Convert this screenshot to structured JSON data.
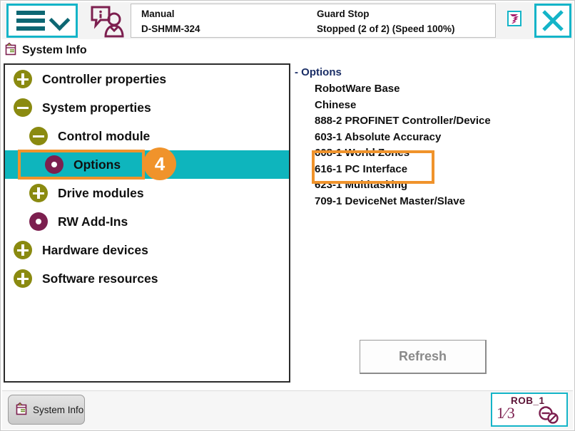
{
  "header": {
    "menu_button_label": "menu",
    "operator_icon": "info-operator-icon",
    "status": {
      "mode": "Manual",
      "system_name": "D-SHMM-324",
      "guard": "Guard Stop",
      "execution": "Stopped (2 of 2) (Speed 100%)"
    },
    "task_badge_icon": "task-status-icon",
    "close_button_icon": "close-icon"
  },
  "window": {
    "title": "System Info",
    "title_icon": "system-info-icon"
  },
  "tree": {
    "items": [
      {
        "label": "Controller properties",
        "marker": "plus",
        "indent": 0,
        "selected": false
      },
      {
        "label": "System properties",
        "marker": "minus",
        "indent": 0,
        "selected": false
      },
      {
        "label": "Control module",
        "marker": "minus",
        "indent": 1,
        "selected": false
      },
      {
        "label": "Options",
        "marker": "leaf",
        "indent": 2,
        "selected": true
      },
      {
        "label": "Drive modules",
        "marker": "plus",
        "indent": 1,
        "selected": false
      },
      {
        "label": "RW Add-Ins",
        "marker": "leaf",
        "indent": 1,
        "selected": false
      },
      {
        "label": "Hardware devices",
        "marker": "plus",
        "indent": 0,
        "selected": false
      },
      {
        "label": "Software resources",
        "marker": "plus",
        "indent": 0,
        "selected": false
      }
    ],
    "annotation_step": "4"
  },
  "options": {
    "root_label": "- Options",
    "items": [
      "RobotWare Base",
      "Chinese",
      "888-2 PROFINET Controller/Device",
      "603-1 Absolute Accuracy",
      "608-1 World Zones",
      "616-1 PC Interface",
      "623-1 Multitasking",
      "709-1 DeviceNet Master/Slave"
    ],
    "refresh_label": "Refresh"
  },
  "bottom": {
    "taskbar_label": "System Info",
    "taskbar_icon": "system-info-icon",
    "robot_name": "ROB_1",
    "robot_fraction_numerator": "1",
    "robot_fraction_denominator": "3",
    "motor_icon": "motors-off-icon"
  },
  "colors": {
    "accent_teal": "#14b4c8",
    "selection_teal": "#0eb5bd",
    "annotation_orange": "#f0932b",
    "node_olive": "#8a8a10",
    "node_magenta": "#7c1f4f",
    "options_root_blue": "#1a2e66"
  }
}
